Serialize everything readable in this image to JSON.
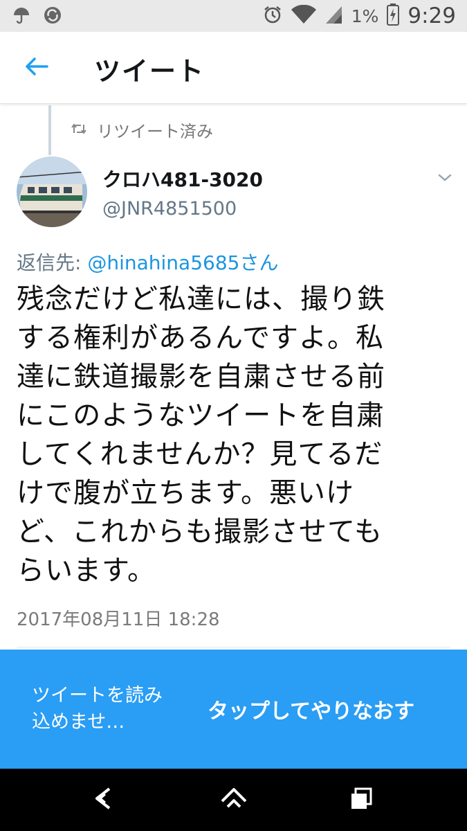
{
  "status_bar": {
    "battery_text": "1%",
    "time": "9:29",
    "icons": [
      "umbrella-icon",
      "sync-icon",
      "alarm-icon",
      "wifi-icon",
      "signal-icon",
      "battery-charging-icon"
    ]
  },
  "header": {
    "title": "ツイート",
    "back_icon": "back-arrow-icon"
  },
  "tweet": {
    "retweet_label": "リツイート済み",
    "author_name": "クロハ481-3020",
    "author_handle": "@JNR4851500",
    "reply_prefix": "返信先: ",
    "reply_handle": "@hinahina5685さん",
    "body_lines": [
      "残念だけど私達には、撮り鉄",
      "する権利があるんですよ。私",
      "達に鉄道撮影を自粛させる前",
      "にこのようなツイートを自粛",
      "してくれませんか？見てるだ",
      "けで腹が立ちます。悪いけ",
      "ど、これからも撮影させても",
      "らいます。"
    ],
    "timestamp": "2017年08月11日 18:28"
  },
  "error_banner": {
    "message": "ツイートを読み込めませ…",
    "action_label": "タップしてやりなおす"
  },
  "colors": {
    "accent": "#1da1f2",
    "banner": "#2a9df4",
    "link": "#1b95e0"
  }
}
